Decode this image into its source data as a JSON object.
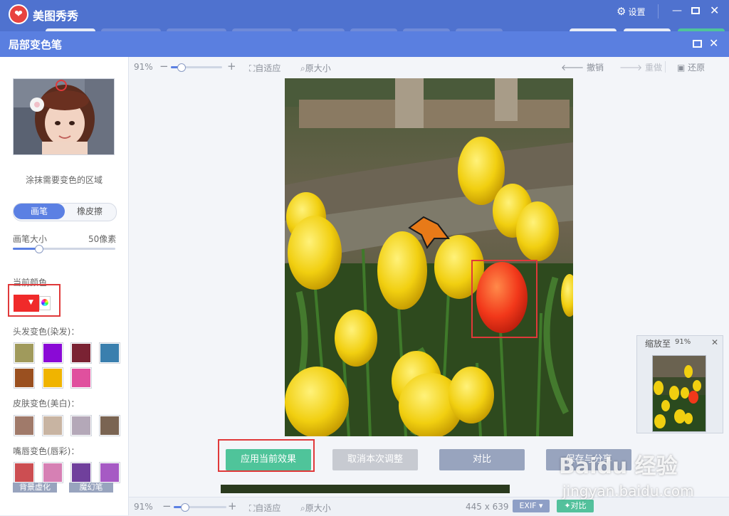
{
  "app": {
    "title": "美图秀秀",
    "settings_label": "设置"
  },
  "dialog": {
    "title": "局部变色笔"
  },
  "left": {
    "hint": "涂抹需要变色的区域",
    "mode_brush": "画笔",
    "mode_eraser": "橡皮擦",
    "brush_size_label": "画笔大小",
    "brush_size_value": "50像素",
    "brush_size_fraction": 0.25,
    "current_color_label": "当前颜色",
    "current_color": "#f02a2a",
    "hair_label": "头发变色(染发)：",
    "hair_colors": [
      "#a09a5c",
      "#8a0ad6",
      "#7a2233",
      "#3a7fae",
      "#9a5020",
      "#f0b400",
      "#e0509e"
    ],
    "skin_label": "皮肤变色(美白)：",
    "skin_colors": [
      "#a07a6a",
      "#c8b4a2",
      "#b4a8b8",
      "#7a6452"
    ],
    "lip_label": "嘴唇变色(唇彩)：",
    "lip_colors": [
      "#cc4e52",
      "#d680b4",
      "#70409c",
      "#a65ac4"
    ],
    "bottom_btn1": "背景虚化",
    "bottom_btn2": "魔幻笔"
  },
  "toolbar": {
    "zoom": "91%",
    "zoom_fraction": 0.2,
    "fit": "自适应",
    "original": "原大小",
    "undo": "撤销",
    "redo": "重做",
    "restore": "还原"
  },
  "navigator": {
    "label": "缩放至",
    "value": "91%"
  },
  "actions": {
    "apply": "应用当前效果",
    "cancel": "取消本次调整",
    "compare": "对比",
    "save": "保存与分享"
  },
  "bottom": {
    "zoom": "91%",
    "fit": "自适应",
    "original": "原大小",
    "dimensions": "445 x 639",
    "exif": "EXIF ▾",
    "compare": "对比"
  },
  "watermark": {
    "logo": "Baidu 经验",
    "url": "jingyan.baidu.com"
  }
}
